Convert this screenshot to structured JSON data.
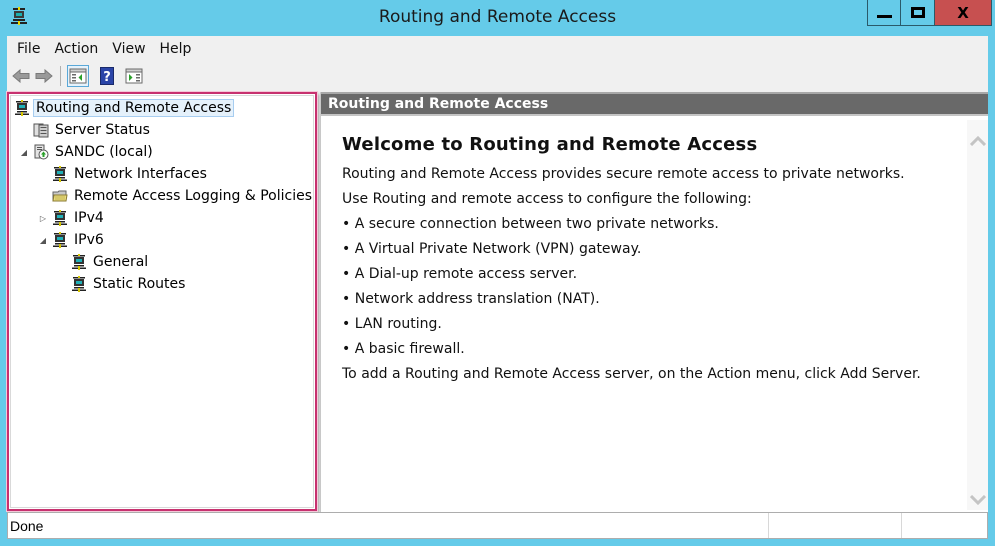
{
  "window": {
    "title": "Routing and Remote Access",
    "controls": {
      "minimize": "minimize",
      "maximize": "maximize",
      "close": "X"
    }
  },
  "menubar": {
    "items": [
      {
        "label": "File"
      },
      {
        "label": "Action"
      },
      {
        "label": "View"
      },
      {
        "label": "Help"
      }
    ]
  },
  "toolbar": {
    "buttons": [
      {
        "name": "back",
        "icon": "back-arrow-icon",
        "enabled": false
      },
      {
        "name": "forward",
        "icon": "forward-arrow-icon",
        "enabled": false
      },
      {
        "name": "show-hide-console-tree",
        "icon": "console-tree-icon",
        "active": true
      },
      {
        "name": "help",
        "icon": "help-icon",
        "glyph": "?"
      },
      {
        "name": "show-hide-action-pane",
        "icon": "action-pane-icon"
      }
    ]
  },
  "tree": {
    "items": [
      {
        "label": "Routing and Remote Access",
        "icon": "network-computer-icon",
        "level": 0,
        "selected": true
      },
      {
        "label": "Server Status",
        "icon": "server-status-icon",
        "level": 1
      },
      {
        "label": "SANDC (local)",
        "icon": "server-local-icon",
        "level": 1,
        "expanded": true
      },
      {
        "label": "Network Interfaces",
        "icon": "network-computer-icon",
        "level": 2
      },
      {
        "label": "Remote Access Logging & Policies",
        "icon": "folder-icon",
        "level": 2
      },
      {
        "label": "IPv4",
        "icon": "network-computer-icon",
        "level": 2,
        "expanded": false
      },
      {
        "label": "IPv6",
        "icon": "network-computer-icon",
        "level": 2,
        "expanded": true
      },
      {
        "label": "General",
        "icon": "network-computer-icon",
        "level": 3
      },
      {
        "label": "Static Routes",
        "icon": "network-computer-icon",
        "level": 3
      }
    ]
  },
  "content": {
    "header": "Routing and Remote Access",
    "heading": "Welcome to Routing and Remote Access",
    "intro": "Routing and Remote Access provides secure remote access to private networks.",
    "lead": "Use Routing and remote access to configure the following:",
    "bullets": [
      "A secure connection between two private networks.",
      "A Virtual Private Network (VPN) gateway.",
      "A Dial-up remote access server.",
      "Network address translation (NAT).",
      "LAN routing.",
      "A basic firewall."
    ],
    "footer": "To add a Routing and Remote Access server, on the Action menu, click Add Server."
  },
  "statusbar": {
    "text": "Done",
    "cells": [
      "",
      ""
    ]
  },
  "colors": {
    "titlebar": "#65cbe9",
    "close_button": "#c75050",
    "selection_highlight": "#c7316f",
    "content_header": "#696969"
  }
}
